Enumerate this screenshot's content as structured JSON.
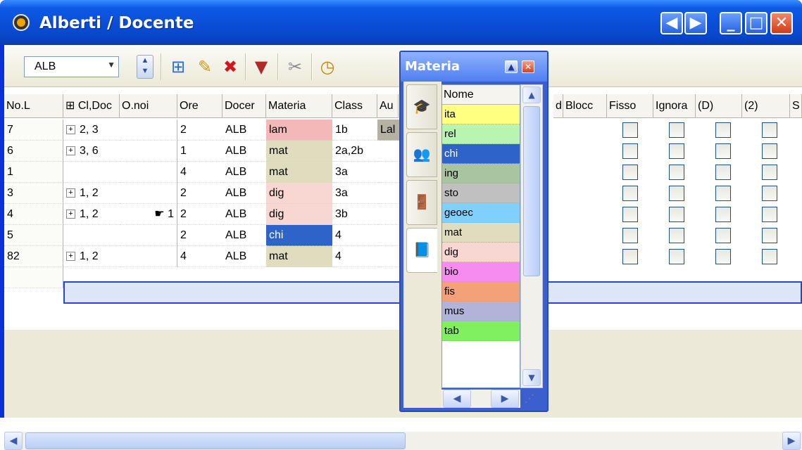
{
  "window": {
    "title": "Alberti / Docente",
    "controls": {
      "prev": "◀",
      "next": "▶",
      "minimize": "_",
      "maximize": "□",
      "close": "✕"
    }
  },
  "toolbar": {
    "teacher_select": "ALB",
    "icons": [
      "view-grid-icon",
      "new-icon",
      "delete-icon",
      "filter-icon",
      "tools-icon",
      "clock-icon"
    ]
  },
  "grid": {
    "columns": [
      "No.L",
      "Cl,Doc",
      "O.noi",
      "Ore",
      "Docer",
      "Materia",
      "Class",
      "Au",
      "d",
      "Blocc",
      "Fisso",
      "Ignora",
      "(D)",
      "(2)",
      "S"
    ],
    "rows": [
      {
        "nol": "7",
        "cldoc": "2, 3",
        "onoi": "",
        "ore": "2",
        "docer": "ALB",
        "materia": "lam",
        "class": "1b",
        "au": "Lal",
        "color": "#f5b8b8"
      },
      {
        "nol": "6",
        "cldoc": "3, 6",
        "onoi": "",
        "ore": "1",
        "docer": "ALB",
        "materia": "mat",
        "class": "2a,2b",
        "au": "",
        "color": "#e0ddbf"
      },
      {
        "nol": "1",
        "cldoc": "",
        "onoi": "",
        "ore": "4",
        "docer": "ALB",
        "materia": "mat",
        "class": "3a",
        "au": "",
        "color": "#e0ddbf"
      },
      {
        "nol": "3",
        "cldoc": "1, 2",
        "onoi": "",
        "ore": "2",
        "docer": "ALB",
        "materia": "dig",
        "class": "3a",
        "au": "",
        "color": "#f8d6d2"
      },
      {
        "nol": "4",
        "cldoc": "1, 2",
        "onoi": "1",
        "ore": "2",
        "docer": "ALB",
        "materia": "dig",
        "class": "3b",
        "au": "",
        "color": "#f8d6d2"
      },
      {
        "nol": "5",
        "cldoc": "",
        "onoi": "",
        "ore": "2",
        "docer": "ALB",
        "materia": "chi",
        "class": "4",
        "au": "",
        "color": "#2e63c9"
      },
      {
        "nol": "82",
        "cldoc": "1, 2",
        "onoi": "",
        "ore": "4",
        "docer": "ALB",
        "materia": "mat",
        "class": "4",
        "au": "",
        "color": "#e0ddbf"
      }
    ]
  },
  "panel": {
    "title": "Materia",
    "list_header": "Nome",
    "items": [
      {
        "name": "ita",
        "color": "#ffff80"
      },
      {
        "name": "rel",
        "color": "#b8f5b0"
      },
      {
        "name": "chi",
        "color": "#2e63c9"
      },
      {
        "name": "ing",
        "color": "#a8c4a0"
      },
      {
        "name": "sto",
        "color": "#c0c0c0"
      },
      {
        "name": "geoec",
        "color": "#7fd0ff"
      },
      {
        "name": "mat",
        "color": "#e0ddbf"
      },
      {
        "name": "dig",
        "color": "#f8d6d2"
      },
      {
        "name": "bio",
        "color": "#f78cf0"
      },
      {
        "name": "fis",
        "color": "#f4a078"
      },
      {
        "name": "mus",
        "color": "#b0b4d8"
      },
      {
        "name": "tab",
        "color": "#80f060"
      }
    ]
  }
}
